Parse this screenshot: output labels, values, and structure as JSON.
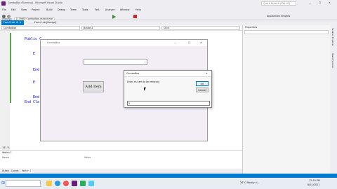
{
  "window": {
    "title": "ComboBox (Running) - Microsoft Visual Studio",
    "quick_launch": "Quick Launch (Ctrl+Q)"
  },
  "menu": [
    "File",
    "Edit",
    "View",
    "Project",
    "Build",
    "Debug",
    "Team",
    "Tools",
    "Test",
    "Analyze",
    "Window",
    "Help"
  ],
  "toolbar": {
    "process_label": "Process:",
    "process_value": "[17960] ComboBox.vshost.exe",
    "app_insights": "Application Insights"
  },
  "tabs": [
    "Form1.vb",
    "Form1.vb [Design]"
  ],
  "nav": {
    "left": "ComboBox",
    "middle": "Button2",
    "right": "Click"
  },
  "code": {
    "lines": [
      "Public C",
      "E",
      "End",
      "E",
      "End",
      "End Cla"
    ],
    "zoom": "101 %"
  },
  "form1": {
    "title": "ComboBox",
    "add_button": "Add Item"
  },
  "dialog": {
    "title": "ComboBox",
    "prompt": "Enter an item to be removed",
    "ok": "OK",
    "cancel": "Cancel",
    "input_value": "5"
  },
  "properties": {
    "title": "Properties"
  },
  "watch": {
    "title": "Watch 1",
    "col_name": "Name",
    "col_value": "Value",
    "tabs": [
      "Autos",
      "Locals",
      "Watch 1"
    ]
  },
  "side_labels": [
    "Solution Explorer",
    "Team Explorer"
  ],
  "tray": {
    "weather": "26°C Mostly cl...",
    "time": "12:19 PM",
    "date": "8/21/2021"
  },
  "colors": {
    "accent": "#007acc",
    "vs_purple": "#68217a"
  }
}
